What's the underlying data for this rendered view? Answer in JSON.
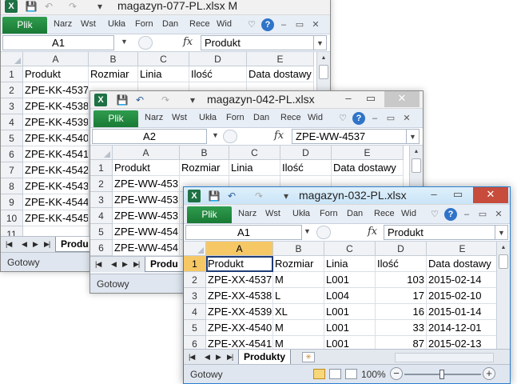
{
  "ui": {
    "plik": "Plik",
    "tabs": [
      "Narz",
      "Wst",
      "Ukła",
      "Forn",
      "Dan",
      "Rece",
      "Wid"
    ],
    "fx": "fx",
    "minimize": "–",
    "restore": "▭",
    "close": "✕"
  },
  "windows": {
    "w1": {
      "title": "magazyn-077-PL.xlsx M",
      "namebox": "A1",
      "formula": "Produkt",
      "columns": [
        "A",
        "B",
        "C",
        "D",
        "E"
      ],
      "rows": [
        "1",
        "2",
        "3",
        "4",
        "5",
        "6",
        "7",
        "8",
        "9",
        "10",
        "11"
      ],
      "cells": [
        [
          "Produkt",
          "Rozmiar",
          "Linia",
          "Ilość",
          "Data dostawy"
        ],
        [
          "ZPE-KK-4537",
          "",
          "",
          "",
          ""
        ],
        [
          "ZPE-KK-4538",
          "",
          "",
          "",
          ""
        ],
        [
          "ZPE-KK-4539",
          "",
          "",
          "",
          ""
        ],
        [
          "ZPE-KK-4540",
          "",
          "",
          "",
          ""
        ],
        [
          "ZPE-KK-4541",
          "",
          "",
          "",
          ""
        ],
        [
          "ZPE-KK-4542",
          "",
          "",
          "",
          ""
        ],
        [
          "ZPE-KK-4543",
          "",
          "",
          "",
          ""
        ],
        [
          "ZPE-KK-4544",
          "",
          "",
          "",
          ""
        ],
        [
          "ZPE-KK-4545",
          "",
          "",
          "",
          ""
        ]
      ],
      "sheet_tab": "Produ",
      "status": "Gotowy"
    },
    "w2": {
      "title": "magazyn-042-PL.xlsx",
      "namebox": "A2",
      "formula": "ZPE-WW-4537",
      "columns": [
        "A",
        "B",
        "C",
        "D",
        "E"
      ],
      "rows": [
        "1",
        "2",
        "3",
        "4",
        "5",
        "6"
      ],
      "cells": [
        [
          "Produkt",
          "Rozmiar",
          "Linia",
          "Ilość",
          "Data dostawy"
        ],
        [
          "ZPE-WW-453",
          "",
          "",
          "",
          ""
        ],
        [
          "ZPE-WW-453",
          "",
          "",
          "",
          ""
        ],
        [
          "ZPE-WW-453",
          "",
          "",
          "",
          ""
        ],
        [
          "ZPE-WW-454",
          "",
          "",
          "",
          ""
        ],
        [
          "ZPE-WW-454",
          "",
          "",
          "",
          ""
        ]
      ],
      "sheet_tab": "Produ",
      "status": "Gotowy"
    },
    "w3": {
      "title": "magazyn-032-PL.xlsx",
      "namebox": "A1",
      "formula": "Produkt",
      "columns": [
        "A",
        "B",
        "C",
        "D",
        "E"
      ],
      "rows": [
        "1",
        "2",
        "3",
        "4",
        "5",
        "6"
      ],
      "cells": [
        [
          "Produkt",
          "Rozmiar",
          "Linia",
          "Ilość",
          "Data dostawy"
        ],
        [
          "ZPE-XX-4537",
          "M",
          "L001",
          "103",
          "2015-02-14"
        ],
        [
          "ZPE-XX-4538",
          "L",
          "L004",
          "17",
          "2015-02-10"
        ],
        [
          "ZPE-XX-4539",
          "XL",
          "L001",
          "16",
          "2015-01-14"
        ],
        [
          "ZPE-XX-4540",
          "M",
          "L001",
          "33",
          "2014-12-01"
        ],
        [
          "ZPE-XX-4541",
          "M",
          "L001",
          "87",
          "2015-02-13"
        ]
      ],
      "sheet_tab": "Produkty",
      "status": "Gotowy",
      "zoom": "100%"
    }
  }
}
